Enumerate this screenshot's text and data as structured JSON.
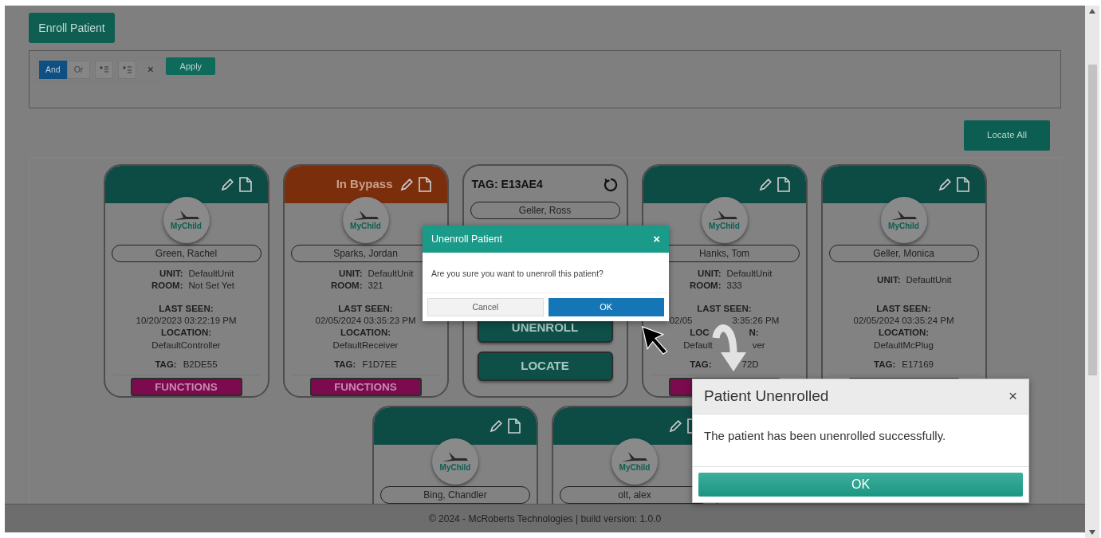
{
  "enroll_button": "Enroll Patient",
  "filter": {
    "operators": [
      {
        "label": "And",
        "selected": true
      },
      {
        "label": "Or",
        "selected": false
      }
    ],
    "clear_icon": "×",
    "apply": "Apply"
  },
  "locate_all": "Locate All",
  "cards": [
    {
      "kind": "patient",
      "header": {
        "kind": "normal"
      },
      "logo": "MyChild",
      "name": "Green, Rachel",
      "unit_label": "UNIT:",
      "unit": "DefaultUnit",
      "room_label": "ROOM:",
      "room": "Not Set Yet",
      "last_seen_label": "LAST SEEN:",
      "last_seen": "10/20/2023 03:22:19 PM",
      "location_label": "LOCATION:",
      "location": "DefaultController",
      "tag_label": "TAG:",
      "tag": "B2DE55",
      "has_functions": true,
      "functions": "FUNCTIONS"
    },
    {
      "kind": "patient",
      "header": {
        "kind": "bypass",
        "text": "In Bypass"
      },
      "logo": "MyChild",
      "name": "Sparks, Jordan",
      "unit_label": "UNIT:",
      "unit": "DefaultUnit",
      "room_label": "ROOM:",
      "room": "321",
      "last_seen_label": "LAST SEEN:",
      "last_seen": "02/05/2024 03:35:23 PM",
      "location_label": "LOCATION:",
      "location": "DefaultReceiver",
      "tag_label": "TAG:",
      "tag": "F1D7EE",
      "has_functions": true,
      "functions": "FUNCTIONS"
    },
    {
      "kind": "tag",
      "header": {
        "kind": "tag",
        "text": "TAG: E13AE4"
      },
      "name": "Geller, Ross",
      "buttons": [
        "UNENROLL",
        "LOCATE"
      ]
    },
    {
      "kind": "patient",
      "header": {
        "kind": "normal"
      },
      "logo": "MyChild",
      "name": "Hanks, Tom",
      "unit_label": "UNIT:",
      "unit": "DefaultUnit",
      "room_label": "ROOM:",
      "room": "333",
      "last_seen_label": "LAST SEEN:",
      "last_seen": [
        "02/05",
        "3:35:26 PM"
      ],
      "location_label": [
        "LOC",
        "N:"
      ],
      "location": [
        "Default",
        "ver"
      ],
      "tag_label": "TAG:",
      "tag": [
        "72D"
      ],
      "has_functions": true
    },
    {
      "kind": "patient",
      "header": {
        "kind": "normal"
      },
      "logo": "MyChild",
      "name": "Geller, Monica",
      "unit_label": "UNIT:",
      "unit": "DefaultUnit",
      "last_seen_label": "LAST SEEN:",
      "last_seen": "02/05/2024 03:35:24 PM",
      "location_label": "LOCATION:",
      "location": "DefaultMcPlug",
      "tag_label": "TAG:",
      "tag": "E17169",
      "has_functions": true
    },
    {
      "kind": "patient",
      "header": {
        "kind": "normal"
      },
      "logo": "MyChild",
      "name": "Bing, Chandler"
    },
    {
      "kind": "patient",
      "header": {
        "kind": "normal"
      },
      "logo": "MyChild",
      "name": "olt, alex"
    }
  ],
  "footer": "© 2024 - McRoberts Technologies | build version: 1.0.0",
  "confirm_dialog": {
    "title": "Unenroll Patient",
    "close": "×",
    "message": "Are you sure you want to unenroll this patient?",
    "cancel": "Cancel",
    "ok": "OK"
  },
  "success_dialog": {
    "title": "Patient Unenrolled",
    "close": "×",
    "message": "The patient has been unenrolled successfully.",
    "ok": "OK"
  }
}
